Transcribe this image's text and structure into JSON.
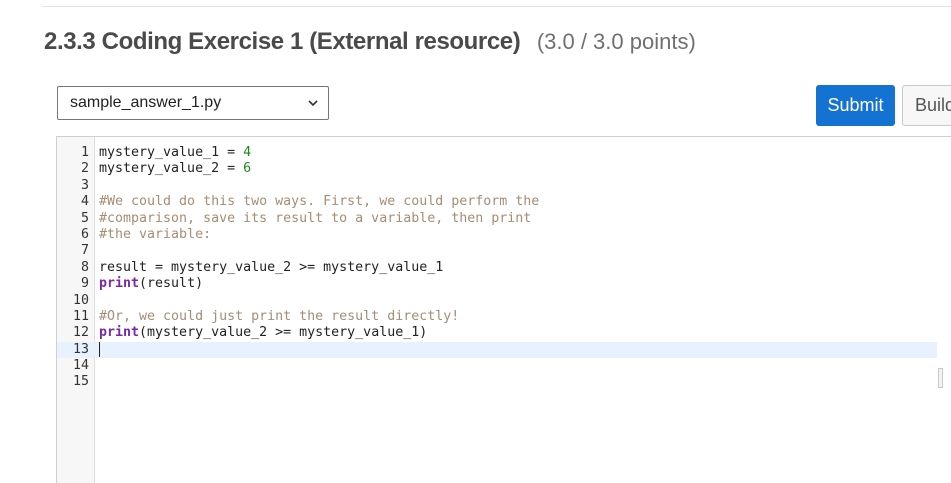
{
  "header": {
    "title": "2.3.3 Coding Exercise 1 (External resource)",
    "points": "(3.0 / 3.0 points)"
  },
  "toolbar": {
    "file_select_value": "sample_answer_1.py",
    "submit_label": "Submit",
    "build_label": "Build"
  },
  "editor": {
    "lines": [
      {
        "num": "1",
        "tokens": [
          {
            "t": "mystery_value_1 = ",
            "c": "plain"
          },
          {
            "t": "4",
            "c": "num"
          }
        ]
      },
      {
        "num": "2",
        "tokens": [
          {
            "t": "mystery_value_2 = ",
            "c": "plain"
          },
          {
            "t": "6",
            "c": "num"
          }
        ]
      },
      {
        "num": "3",
        "tokens": []
      },
      {
        "num": "4",
        "tokens": [
          {
            "t": "#We could do this two ways. First, we could perform the",
            "c": "comment"
          }
        ]
      },
      {
        "num": "5",
        "tokens": [
          {
            "t": "#comparison, save its result to a variable, then print",
            "c": "comment"
          }
        ]
      },
      {
        "num": "6",
        "tokens": [
          {
            "t": "#the variable:",
            "c": "comment"
          }
        ]
      },
      {
        "num": "7",
        "tokens": []
      },
      {
        "num": "8",
        "tokens": [
          {
            "t": "result = mystery_value_2 >= mystery_value_1",
            "c": "plain"
          }
        ]
      },
      {
        "num": "9",
        "tokens": [
          {
            "t": "print",
            "c": "kw"
          },
          {
            "t": "(result)",
            "c": "plain"
          }
        ]
      },
      {
        "num": "10",
        "tokens": []
      },
      {
        "num": "11",
        "tokens": [
          {
            "t": "#Or, we could just print the result directly!",
            "c": "comment"
          }
        ]
      },
      {
        "num": "12",
        "tokens": [
          {
            "t": "print",
            "c": "kw"
          },
          {
            "t": "(mystery_value_2 >= mystery_value_1)",
            "c": "plain"
          }
        ]
      },
      {
        "num": "13",
        "tokens": [],
        "active": true
      },
      {
        "num": "14",
        "tokens": []
      },
      {
        "num": "15",
        "tokens": []
      }
    ]
  },
  "colors": {
    "submit_bg": "#1473d2",
    "number": "#1a8a1a",
    "comment": "#a48e74",
    "keyword": "#7a2aa6",
    "active_line": "#e8f2ff"
  }
}
